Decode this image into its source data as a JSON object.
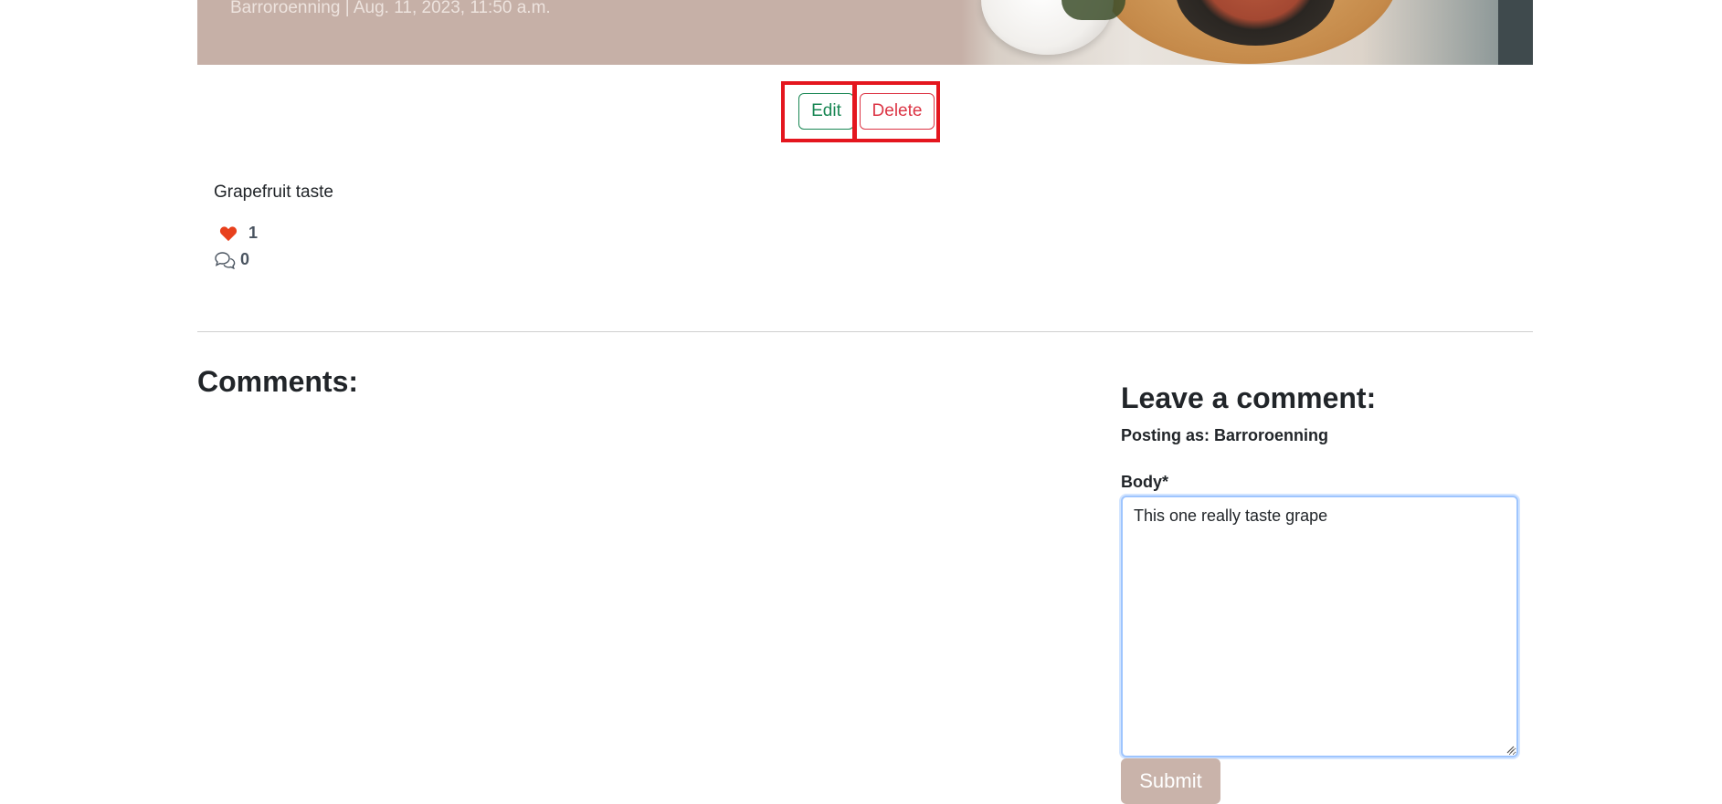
{
  "post": {
    "meta": "Barroroenning | Aug. 11, 2023, 11:50 a.m.",
    "body": "Grapefruit taste",
    "likes": "1",
    "comments_count": "0"
  },
  "actions": {
    "edit_label": "Edit",
    "delete_label": "Delete"
  },
  "comments_section": {
    "title": "Comments:"
  },
  "comment_form": {
    "title": "Leave a comment:",
    "posting_as": "Posting as: Barroroenning",
    "body_label": "Body*",
    "body_value": "This one really taste grape",
    "submit_label": "Submit"
  },
  "icons": {
    "like": "heart-icon",
    "comments": "chat-bubbles-icon"
  },
  "colors": {
    "hero_bg": "#c6b0a7",
    "edit": "#198754",
    "delete": "#dc3545",
    "heart": "#e8401c",
    "submit_bg": "#c9b3aa",
    "highlight": "#e4161e"
  }
}
